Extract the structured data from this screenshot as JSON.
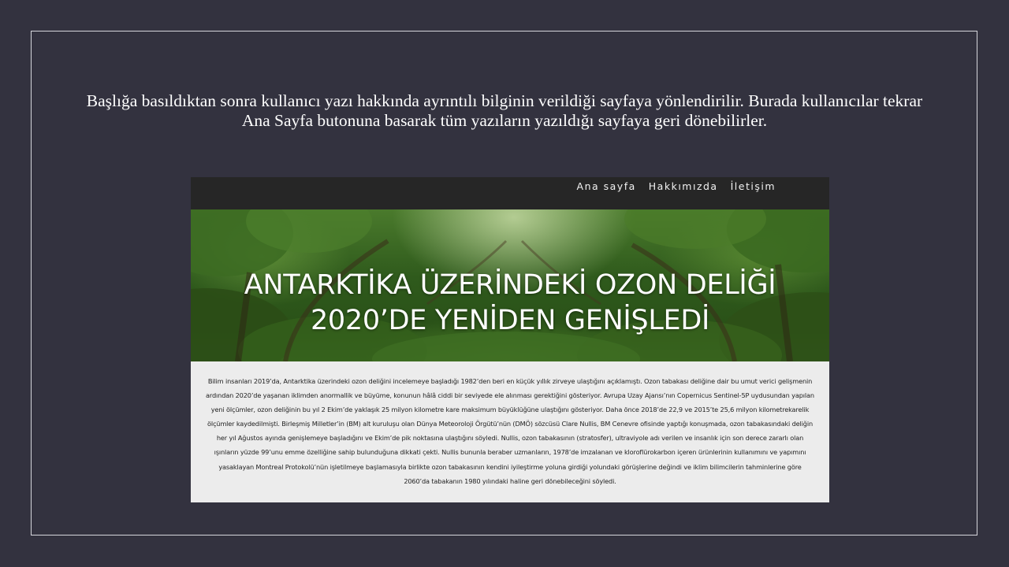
{
  "slide": {
    "caption": "Başlığa basıldıktan sonra kullanıcı yazı hakkında ayrıntılı bilginin verildiği sayfaya yönlendirilir. Burada kullanıcılar tekrar Ana Sayfa butonuna basarak tüm yazıların yazıldığı sayfaya geri dönebilirler."
  },
  "site": {
    "nav": {
      "items": [
        {
          "label": "Ana sayfa"
        },
        {
          "label": "Hakkımızda"
        },
        {
          "label": "İletişim"
        }
      ]
    },
    "hero": {
      "title_line1": "ANTARKTİKA ÜZERİNDEKİ OZON DELİĞİ",
      "title_line2": "2020’DE YENİDEN GENİŞLEDİ",
      "background_icon": "forest-image"
    },
    "article": {
      "body": "Bilim insanları 2019’da, Antarktika üzerindeki ozon deliğini incelemeye başladığı 1982’den beri en küçük yıllık zirveye ulaştığını açıklamıştı. Ozon tabakası deliğine dair bu umut verici gelişmenin ardından 2020’de yaşanan iklimden anormallik ve büyüme, konunun hâlâ ciddi bir seviyede ele alınması gerektiğini gösteriyor. Avrupa Uzay Ajansı’nın Copernicus Sentinel-5P uydusundan yapılan yeni ölçümler, ozon deliğinin bu yıl 2 Ekim’de yaklaşık 25 milyon kilometre kare maksimum büyüklüğüne ulaştığını gösteriyor. Daha önce 2018’de 22,9 ve 2015’te 25,6 milyon kilometrekarelik ölçümler kaydedilmişti. Birleşmiş Milletler’in (BM) alt kuruluşu olan Dünya Meteoroloji Örgütü’nün (DMÖ) sözcüsü Clare Nullis, BM Cenevre ofisinde yaptığı konuşmada, ozon tabakasındaki deliğin her yıl Ağustos ayında genişlemeye başladığını ve Ekim’de pik noktasına ulaştığını söyledi. Nullis, ozon tabakasının (stratosfer), ultraviyole adı verilen ve insanlık için son derece zararlı olan ışınların yüzde 99’unu emme özelliğine sahip bulunduğuna dikkati çekti. Nullis bununla beraber uzmanların, 1978’de imzalanan ve kloroflürokarbon içeren ürünlerinin kullanımını ve yapımını yasaklayan Montreal Protokolü’nün işletilmeye başlamasıyla birlikte ozon tabakasının kendini iyileştirme yoluna girdiği yolundaki görüşlerine değindi ve iklim bilimcilerin tahminlerine göre 2060’da tabakanın 1980 yılındaki haline geri dönebileceğini söyledi."
    }
  },
  "colors": {
    "slide_background": "#33323f",
    "navbar_background": "#262626",
    "article_background": "#ececec"
  }
}
